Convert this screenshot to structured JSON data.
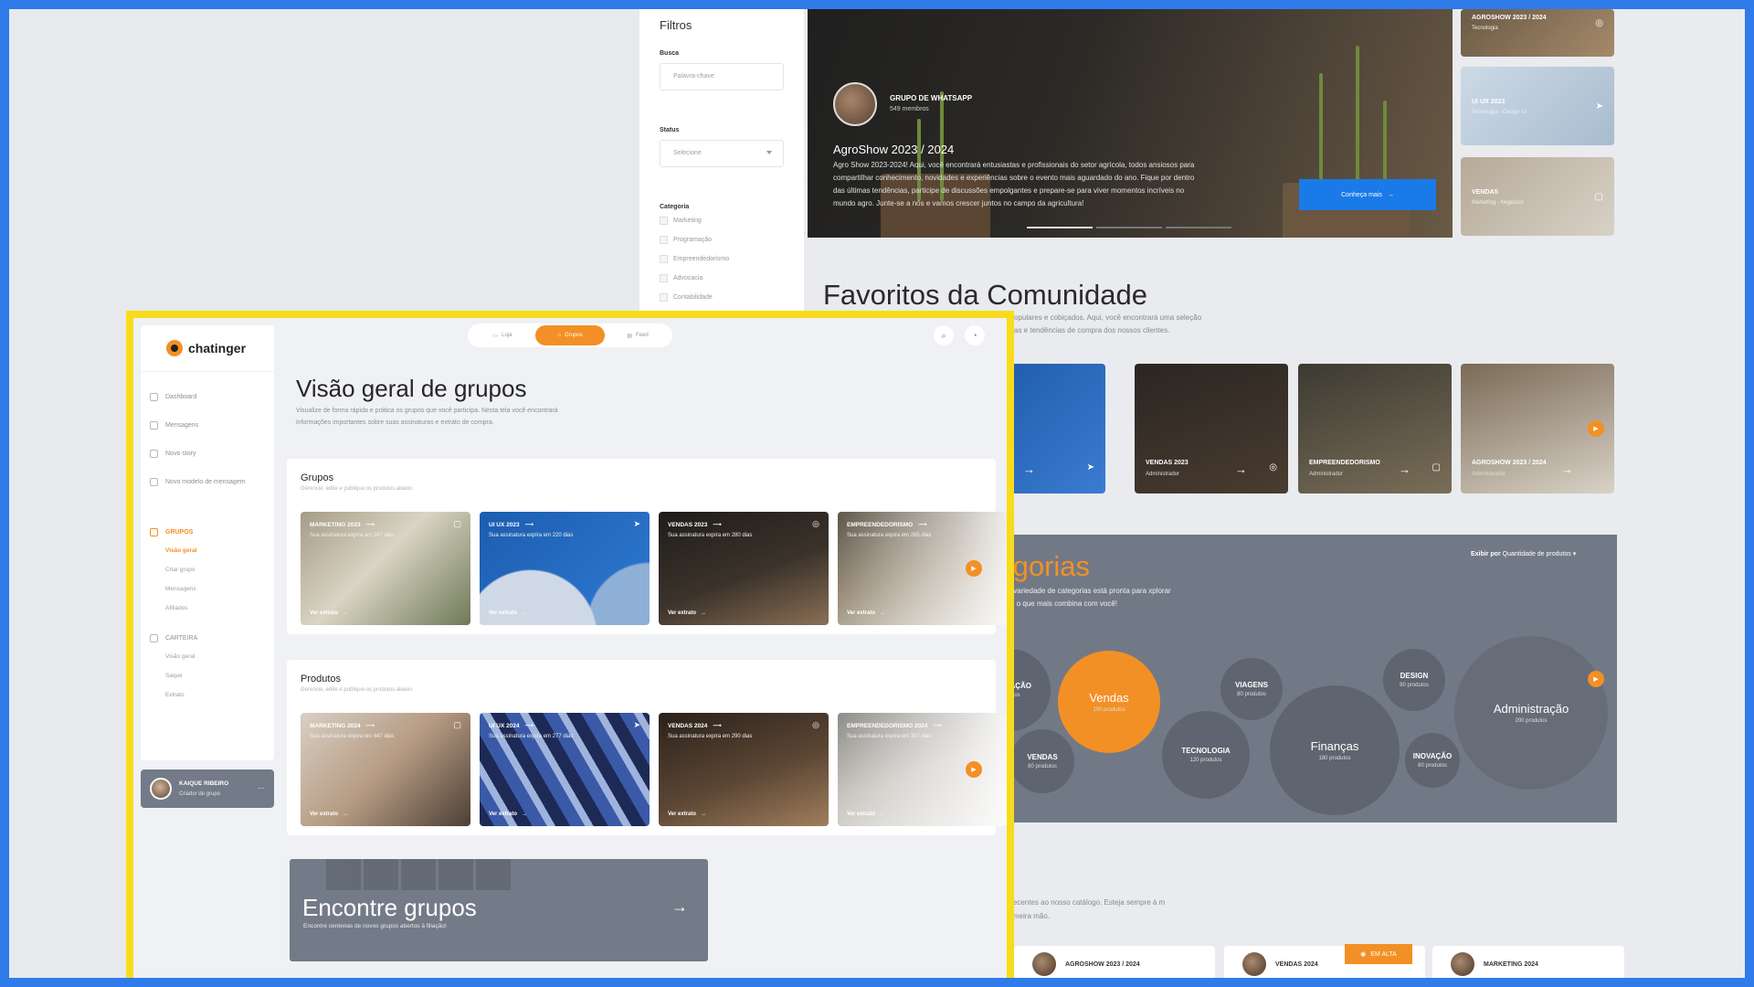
{
  "back": {
    "filters": {
      "title": "Filtros",
      "search_label": "Busca",
      "search_placeholder": "Palavra-chave",
      "status_label": "Status",
      "status_value": "Selecione",
      "category_label": "Categoria",
      "categories": [
        "Marketing",
        "Programação",
        "Empreendedorismo",
        "Advocacia",
        "Contabilidade"
      ]
    },
    "hero": {
      "group_type": "GRUPO DE WHATSAPP",
      "members": "549 membros",
      "title": "AgroShow 2023 / 2024",
      "description": "Agro Show 2023-2024! Aqui, você encontrará entusiastas e profissionais do setor agrícola, todos ansiosos para compartilhar conhecimento, novidades e experiências sobre o evento mais aguardado do ano. Fique por dentro das últimas tendências, participe de discussões empolgantes e prepare-se para viver momentos incríveis no mundo agro. Junte-se a nós e vamos crescer juntos no campo da agricultura!",
      "button": "Conheça mais"
    },
    "side_thumbs": [
      {
        "title": "AGROSHOW 2023 / 2024",
        "sub": "Tecnologia"
      },
      {
        "title": "UI UX 2023",
        "sub": "Tecnologia - Design UI"
      },
      {
        "title": "VENDAS",
        "sub": "Marketing - Negócios"
      }
    ],
    "favorites": {
      "title": "Favoritos da Comunidade",
      "sub": "opulares e cobiçados. Aqui, você encontrará uma seleção as e tendências de compra dos nossos clientes.",
      "cards": [
        {
          "name": "2023",
          "role": "ente"
        },
        {
          "name": "VENDAS 2023",
          "role": "Administrador"
        },
        {
          "name": "EMPREENDEDORISMO",
          "role": "Administrador"
        },
        {
          "name": "AGROSHOW 2023 / 2024",
          "role": "Administrador"
        }
      ]
    },
    "categories": {
      "title": "categorias",
      "sub": "da moda, nossa variedade de categorias está pronta para xplorar agora e encontre o que mais combina com você!",
      "sort_label": "Exibir por",
      "sort_value": "Quantidade de produtos",
      "bubbles": [
        {
          "name": "GRAMAÇÃO",
          "count": "produtos"
        },
        {
          "name": "Vendas",
          "count": "150 produtos"
        },
        {
          "name": "VENDAS",
          "count": "80 produtos"
        },
        {
          "name": "VIAGENS",
          "count": "80 produtos"
        },
        {
          "name": "TECNOLOGIA",
          "count": "120 produtos"
        },
        {
          "name": "Finanças",
          "count": "180 produtos"
        },
        {
          "name": "DESIGN",
          "count": "80 produtos"
        },
        {
          "name": "INOVAÇÃO",
          "count": "80 produtos"
        },
        {
          "name": "Administração",
          "count": "200 produtos"
        }
      ]
    },
    "news": {
      "sub": "s recentes ao nosso catálogo. Esteja sempre à m primeira mão.",
      "hot": "EM ALTA",
      "cards": [
        "AGROSHOW 2023 / 2024",
        "VENDAS 2024",
        "MARKETING 2024"
      ]
    }
  },
  "front": {
    "brand": "chatinger",
    "nav": {
      "dashboard": "Dashboard",
      "messages": "Mensagens",
      "new_story": "Novo story",
      "new_template": "Novo modelo de mensagem",
      "groups": "GRUPOS",
      "groups_sub": [
        "Visão geral",
        "Criar grupo",
        "Mensagens",
        "Afiliados"
      ],
      "wallet": "CARTEIRA",
      "wallet_sub": [
        "Visão geral",
        "Saque",
        "Extrato"
      ]
    },
    "user": {
      "name": "KAIQUE RIBEIRO",
      "role": "Criador de grupo"
    },
    "tabs": [
      "Loja",
      "Grupos",
      "Feed"
    ],
    "page_title": "Visão geral de grupos",
    "page_desc": "Visualize de forma rápida e prática os grupos que você participa. Nesta tela você encontrará informações importantes sobre suas assinaturas e extrato de compra.",
    "groups": {
      "title": "Grupos",
      "sub": "Gerencie, edite e publique os produtos abaixo",
      "cards": [
        {
          "name": "MARKETING 2023",
          "expiry": "Sua assinatura expira em 247 dias",
          "link": "Ver extrato"
        },
        {
          "name": "UI UX 2023",
          "expiry": "Sua assinatura expira em 220 dias",
          "link": "Ver extrato"
        },
        {
          "name": "VENDAS 2023",
          "expiry": "Sua assinatura expira em 280 dias",
          "link": "Ver extrato"
        },
        {
          "name": "EMPREENDEDORISMO",
          "expiry": "Sua assinatura expira em 265 dias",
          "link": "Ver extrato"
        }
      ]
    },
    "products": {
      "title": "Produtos",
      "sub": "Gerencie, edite e publique os produtos abaixo",
      "cards": [
        {
          "name": "MARKETING 2024",
          "expiry": "Sua assinatura expira em 447 dias",
          "link": "Ver extrato"
        },
        {
          "name": "UI UX 2024",
          "expiry": "Sua assinatura expira em 277 dias",
          "link": "Ver extrato"
        },
        {
          "name": "VENDAS 2024",
          "expiry": "Sua assinatura expira em 290 dias",
          "link": "Ver extrato"
        },
        {
          "name": "EMPREENDEDORISMO 2024",
          "expiry": "Sua assinatura expira em 307 dias",
          "link": "Ver extrato"
        }
      ]
    },
    "find": {
      "title": "Encontre grupos",
      "sub": "Encontre centenas de novos grupos abertos à filiação!"
    }
  }
}
